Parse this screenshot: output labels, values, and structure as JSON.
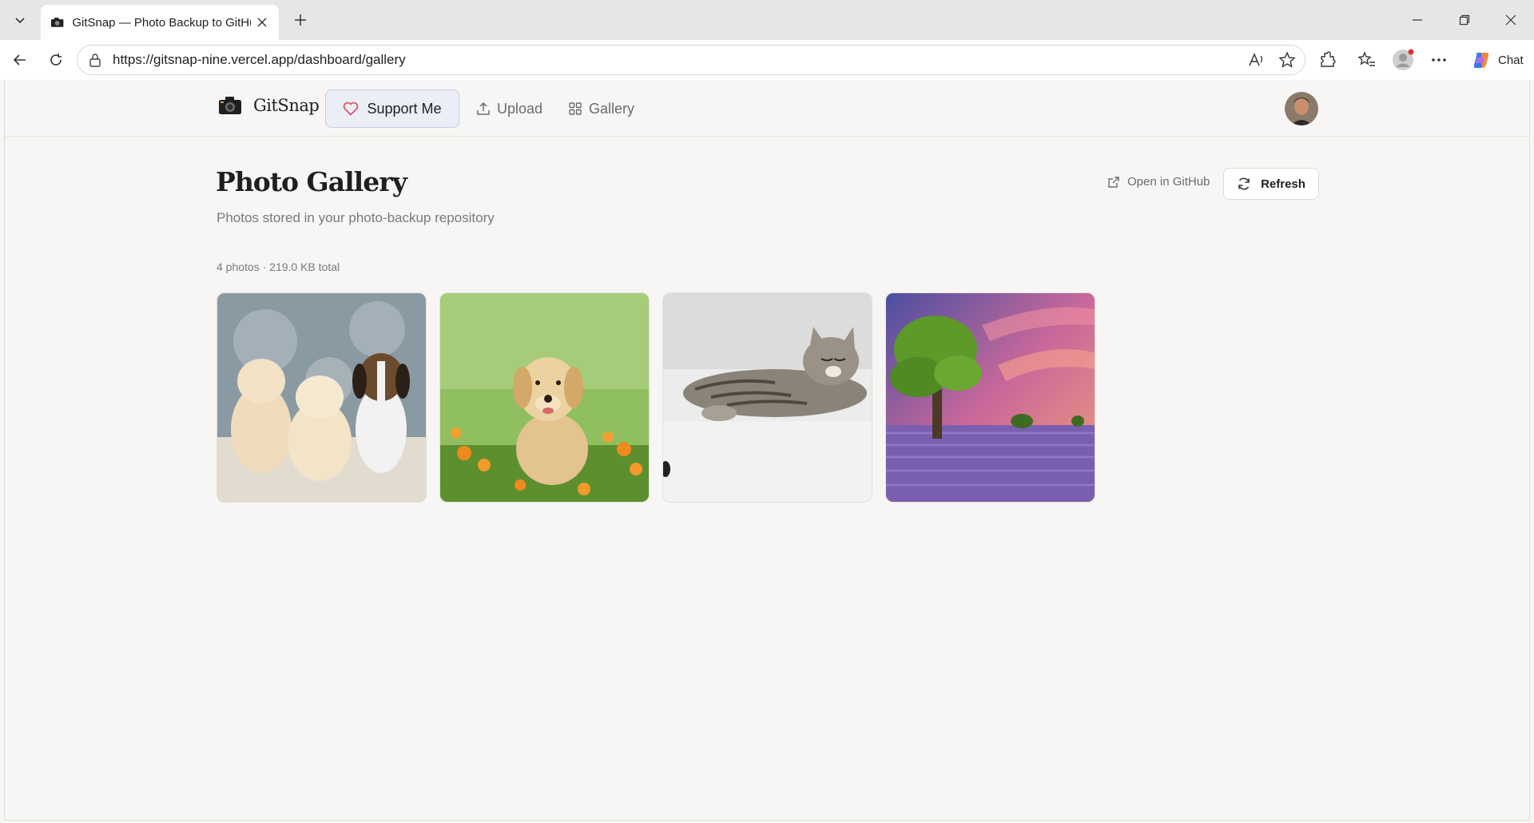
{
  "browser": {
    "tab_title": "GitSnap — Photo Backup to GitHub",
    "url": "https://gitsnap-nine.vercel.app/dashboard/gallery",
    "chat_label": "Chat"
  },
  "header": {
    "logo_text": "GitSnap",
    "support_label": "Support Me",
    "upload_label": "Upload",
    "gallery_label": "Gallery"
  },
  "page": {
    "title": "Photo Gallery",
    "subtitle": "Photos stored in your photo-backup repository",
    "open_github_label": "Open in GitHub",
    "refresh_label": "Refresh",
    "stats": "4 photos · 219.0 KB total"
  },
  "colors": {
    "accent_heart": "#e0556b",
    "support_bg": "#eceef6",
    "page_bg": "#f7f6f4"
  },
  "photos": [
    {
      "subject": "puppies-icon"
    },
    {
      "subject": "golden-puppy-icon"
    },
    {
      "subject": "tabby-cat-icon"
    },
    {
      "subject": "lavender-tree-icon"
    }
  ]
}
